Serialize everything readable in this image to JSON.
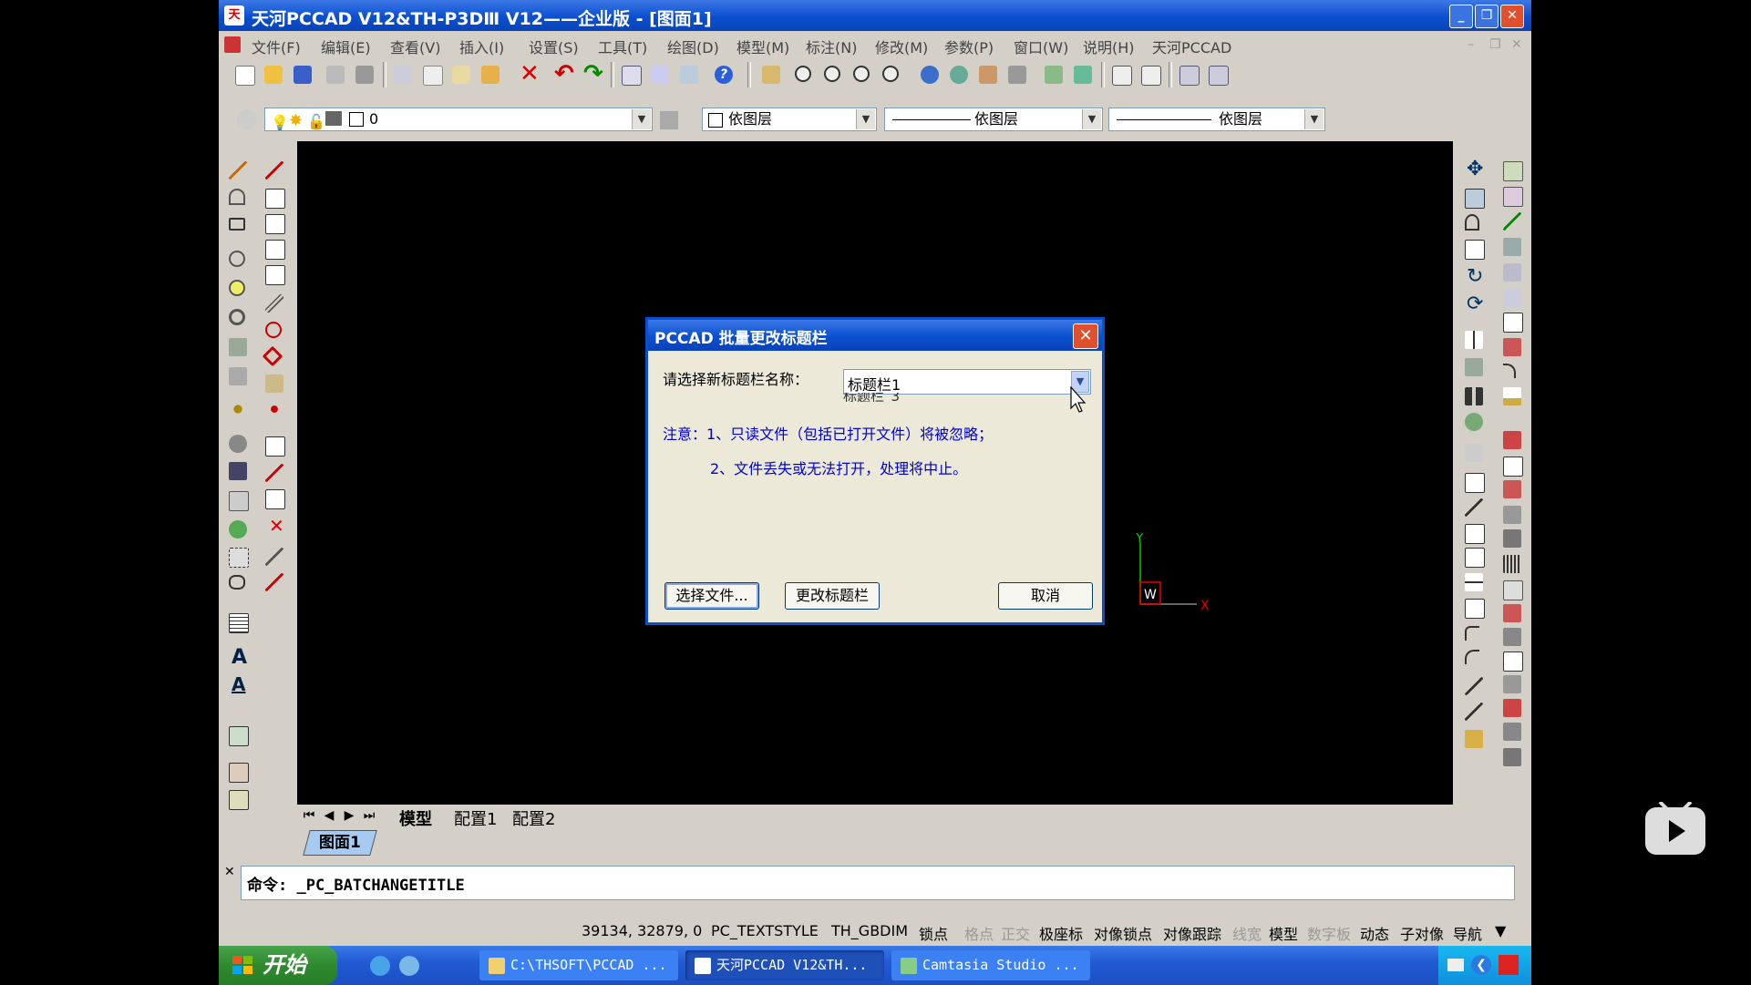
{
  "title": "天河PCCAD V12&TH-P3DⅢ V12——企业版 - [图面1]",
  "menu": [
    "文件(F)",
    "编辑(E)",
    "查看(V)",
    "插入(I)",
    "设置(S)",
    "工具(T)",
    "绘图(D)",
    "模型(M)",
    "标注(N)",
    "修改(M)",
    "参数(P)",
    "窗口(W)",
    "说明(H)",
    "天河PCCAD"
  ],
  "properties": {
    "layer": "0",
    "color": "依图层",
    "linetype": "依图层",
    "lineweight": "依图层"
  },
  "layout_tabs": [
    "模型",
    "配置1",
    "配置2"
  ],
  "document_tab": "图面1",
  "command_line": "命令: _PC_BATCHANGETITLE",
  "status": {
    "coords": "39134, 32879, 0",
    "textstyle": "PC_TEXTSTYLE",
    "dimstyle": "TH_GBDIM",
    "toggles": [
      "锁点",
      "格点",
      "正交",
      "极座标",
      "对像锁点",
      "对像跟踪",
      "线宽",
      "模型",
      "数字板",
      "动态",
      "子对像",
      "导航"
    ]
  },
  "dialog": {
    "title": "PCCAD 批量更改标题栏",
    "label": "请选择新标题栏名称：",
    "selected": "标题栏1",
    "list_peek": "标题栏_3",
    "note1": "注意：1、只读文件（包括已打开文件）将被忽略；",
    "note2": "2、文件丢失或无法打开，处理将中止。",
    "btn_select": "选择文件...",
    "btn_change": "更改标题栏",
    "btn_cancel": "取消"
  },
  "ucs": {
    "x": "X",
    "y": "Y",
    "w": "W"
  },
  "taskbar": {
    "start": "开始",
    "tasks": [
      "C:\\THSOFT\\PCCAD ...",
      "天河PCCAD V12&TH...",
      "Camtasia Studio ..."
    ]
  },
  "colors": {
    "xp_blue": "#0a4fd0",
    "toolbar_bg": "#d4d0c8",
    "dialog_bg": "#ece9d8",
    "note_blue": "#0000cc",
    "taskbar_green": "#2f8a2f"
  }
}
